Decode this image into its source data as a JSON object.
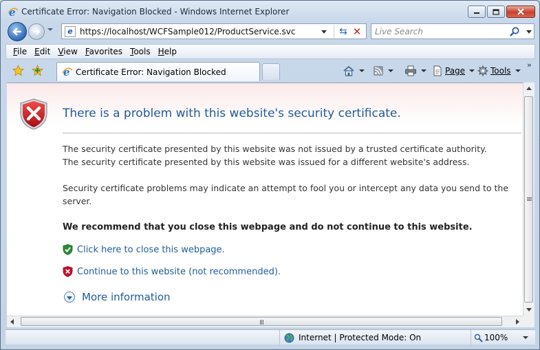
{
  "window": {
    "title": "Certificate Error: Navigation Blocked - Windows Internet Explorer"
  },
  "address_bar": {
    "url": "https://localhost/WCFSample012/ProductService.svc"
  },
  "search": {
    "placeholder": "Live Search"
  },
  "menu": {
    "items": [
      {
        "label_underlined": "F",
        "label_rest": "ile"
      },
      {
        "label_underlined": "E",
        "label_rest": "dit"
      },
      {
        "label_underlined": "V",
        "label_rest": "iew"
      },
      {
        "label_underlined": "F",
        "label_rest": "avorites"
      },
      {
        "label_underlined": "T",
        "label_rest": "ools"
      },
      {
        "label_underlined": "H",
        "label_rest": "elp"
      }
    ]
  },
  "tabs": [
    {
      "label": "Certificate Error: Navigation Blocked"
    }
  ],
  "command_bar": {
    "page_label": "Page",
    "tools_label": "Tools"
  },
  "page": {
    "heading": "There is a problem with this website's security certificate.",
    "para1_line1": "The security certificate presented by this website was not issued by a trusted certificate authority.",
    "para1_line2": "The security certificate presented by this website was issued for a different website's address.",
    "para2_line1": "Security certificate problems may indicate an attempt to fool you or intercept any data you send to the",
    "para2_line2": "server.",
    "recommendation": "We recommend that you close this webpage and do not continue to this website.",
    "close_link": "Click here to close this webpage.",
    "continue_link": "Continue to this website (not recommended).",
    "more_info": "More information"
  },
  "status": {
    "zone": "Internet | Protected Mode: On",
    "zoom": "100%"
  },
  "colors": {
    "link": "#1f5c99",
    "danger": "#c8102e",
    "safe": "#2e8b3a"
  }
}
